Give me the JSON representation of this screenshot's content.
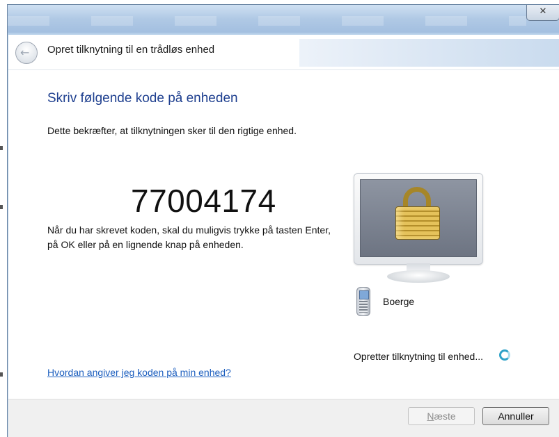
{
  "window": {
    "title": "Opret tilknytning til en trådløs enhed",
    "close_glyph": "✕",
    "back_icon": "back-arrow-icon"
  },
  "main": {
    "heading": "Skriv følgende kode på enheden",
    "subtitle": "Dette bekræfter, at tilknytningen sker til den rigtige enhed.",
    "pairing_code": "77004174",
    "instructions": "Når du har skrevet koden, skal du muligvis trykke på tasten Enter, på OK eller på en lignende knap på enheden.",
    "help_link": "Hvordan angiver jeg koden på min enhed?"
  },
  "device": {
    "name": "Boerge",
    "icon": "mobile-phone-icon",
    "illustration_icon": "padlock-monitor-icon"
  },
  "status": {
    "text": "Opretter tilknytning til enhed...",
    "indicator": "busy-spinner-icon"
  },
  "footer": {
    "next_label_first": "N",
    "next_label_rest": "æste",
    "next_enabled": false,
    "cancel_label": "Annuller"
  },
  "colors": {
    "heading": "#1e3f8f",
    "link": "#1d5fbf",
    "spinner": "#2fa2c8"
  }
}
